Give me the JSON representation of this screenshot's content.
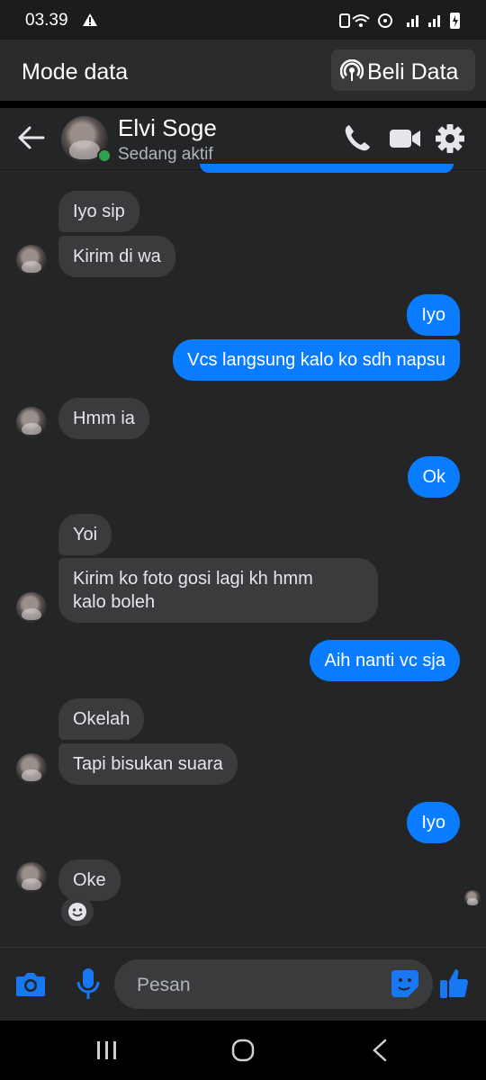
{
  "status_bar": {
    "time": "03.39"
  },
  "banner": {
    "title": "Mode data",
    "button_label": "Beli Data"
  },
  "header": {
    "contact_name": "Elvi Soge",
    "contact_status": "Sedang aktif"
  },
  "messages": [
    {
      "from": "them",
      "text": "Iyo sip"
    },
    {
      "from": "them",
      "text": "Kirim di wa"
    },
    {
      "from": "me",
      "text": "Iyo"
    },
    {
      "from": "me",
      "text": "Vcs langsung kalo ko sdh napsu"
    },
    {
      "from": "them",
      "text": "Hmm ia"
    },
    {
      "from": "me",
      "text": "Ok"
    },
    {
      "from": "them",
      "text": "Yoi"
    },
    {
      "from": "them",
      "text": "Kirim ko foto gosi lagi kh hmm kalo boleh",
      "lines": [
        "Kirim ko foto gosi lagi kh hmm",
        "kalo boleh"
      ]
    },
    {
      "from": "me",
      "text": "Aih nanti vc sja"
    },
    {
      "from": "them",
      "text": "Okelah"
    },
    {
      "from": "them",
      "text": "Tapi bisukan suara"
    },
    {
      "from": "me",
      "text": "Iyo"
    },
    {
      "from": "them",
      "text": "Oke"
    }
  ],
  "composer": {
    "placeholder": "Pesan"
  },
  "colors": {
    "outgoing": "#0a7cff",
    "incoming": "#3a3b3c",
    "background": "#242526",
    "accent": "#1877f2"
  }
}
